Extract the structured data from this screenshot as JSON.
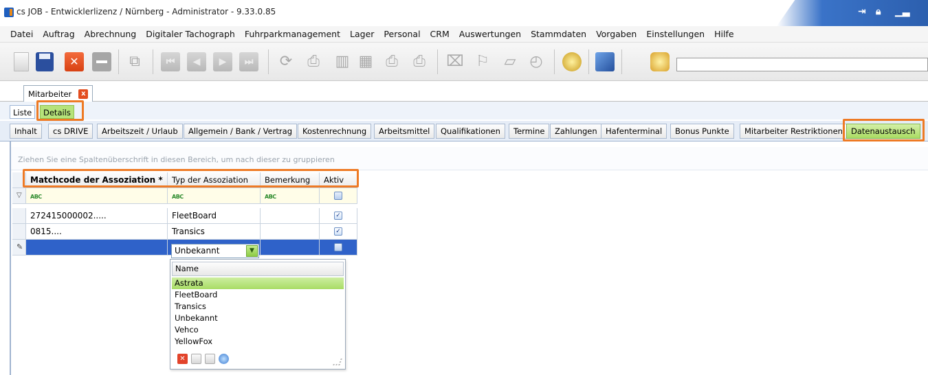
{
  "window": {
    "title": "cs JOB - Entwicklerlizenz / Nürnberg - Administrator - 9.33.0.85"
  },
  "menu": [
    "Datei",
    "Auftrag",
    "Abrechnung",
    "Digitaler Tachograph",
    "Fuhrparkmanagement",
    "Lager",
    "Personal",
    "CRM",
    "Auswertungen",
    "Stammdaten",
    "Vorgaben",
    "Einstellungen",
    "Hilfe"
  ],
  "document_tab": {
    "label": "Mitarbeiter",
    "close_glyph": "x"
  },
  "view_tabs": {
    "liste": "Liste",
    "details": "Details",
    "active": "Details"
  },
  "section_tabs": [
    "Inhalt",
    "cs DRIVE",
    "Arbeitszeit / Urlaub",
    "Allgemein / Bank / Vertrag",
    "Kostenrechnung",
    "Arbeitsmittel",
    "Qualifikationen",
    "Termine",
    "Zahlungen",
    "Hafenterminal",
    "Bonus Punkte",
    "Mitarbeiter Restriktionen",
    "Datenaustausch"
  ],
  "active_section_tab": "Datenaustausch",
  "grid": {
    "group_hint": "Ziehen Sie eine Spaltenüberschrift in diesen Bereich, um nach dieser zu gruppieren",
    "columns": [
      "Matchcode der Assoziation *",
      "Typ der Assoziation",
      "Bemerkung",
      "Aktiv"
    ],
    "filter_glyph": "ABC",
    "rows": [
      {
        "matchcode": "272415000002.....",
        "typ": "FleetBoard",
        "bemerkung": "",
        "aktiv": true
      },
      {
        "matchcode": "0815....",
        "typ": "Transics",
        "bemerkung": "",
        "aktiv": true
      }
    ],
    "editing_row": {
      "matchcode": "",
      "typ": "Unbekannt",
      "aktiv": false
    }
  },
  "dropdown": {
    "header": "Name",
    "items": [
      "Astrata",
      "FleetBoard",
      "Transics",
      "Unbekannt",
      "Vehco",
      "YellowFox"
    ],
    "highlighted": "Astrata"
  },
  "colors": {
    "accent_highlight": "#ee7a24",
    "selected_row": "#2f62c9",
    "active_tab_green": "#a9dc62"
  }
}
